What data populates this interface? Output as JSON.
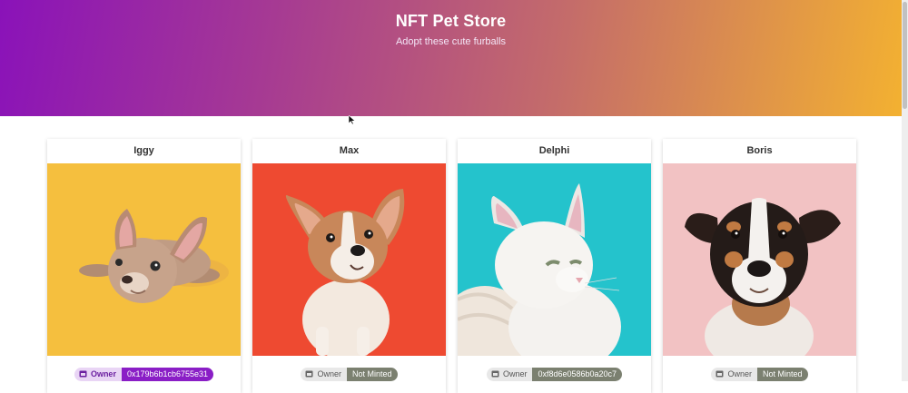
{
  "header": {
    "title": "NFT Pet Store",
    "subtitle": "Adopt these cute furballs"
  },
  "colors": {
    "gradient_start": "#8a12b9",
    "gradient_end": "#f3b131",
    "owner_badge": "#8a1ec6",
    "not_minted_badge": "#7b8070"
  },
  "pets": [
    {
      "name": "Iggy",
      "photo_bg": "#f5bf3e",
      "animal": "french bulldog puppy",
      "owner_label": "Owner",
      "owner_value": "0x179b6b1cb6755e31",
      "status": "owned"
    },
    {
      "name": "Max",
      "photo_bg": "#ee4a31",
      "animal": "corgi puppy",
      "owner_label": "Owner",
      "owner_value": "Not Minted",
      "status": "not-minted"
    },
    {
      "name": "Delphi",
      "photo_bg": "#24c3cc",
      "animal": "white cat",
      "owner_label": "Owner",
      "owner_value": "0xf8d6e0586b0a20c7",
      "status": "owned"
    },
    {
      "name": "Boris",
      "photo_bg": "#f2c2c3",
      "animal": "jack russell terrier",
      "owner_label": "Owner",
      "owner_value": "Not Minted",
      "status": "not-minted"
    }
  ]
}
